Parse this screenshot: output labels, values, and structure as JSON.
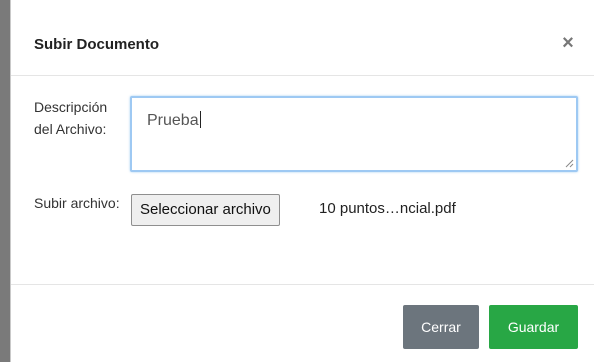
{
  "modal": {
    "title": "Subir Documento",
    "close_glyph": "×"
  },
  "form": {
    "description_label": "Descripción del Archivo:",
    "description_value": "Prueba",
    "file_label": "Subir archivo:",
    "file_button_label": "Seleccionar archivo",
    "file_name": "10 puntos…ncial.pdf"
  },
  "footer": {
    "close_label": "Cerrar",
    "save_label": "Guardar"
  },
  "colors": {
    "save": "#28a745",
    "close": "#6c757d",
    "focus_border": "#9ec9f3"
  }
}
